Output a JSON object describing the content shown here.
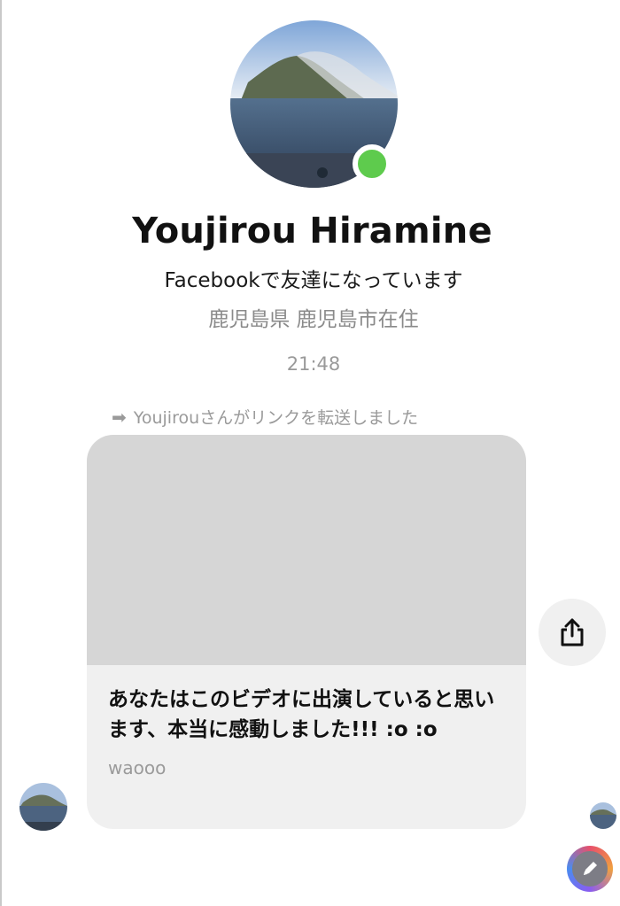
{
  "profile": {
    "name": "Youjirou  Hiramine",
    "friend_status": "Facebookで友達になっています",
    "location": "鹿児島県 鹿児島市在住",
    "online": true
  },
  "thread": {
    "timestamp": "21:48",
    "forward_note": "Youjirouさんがリンクを転送しました"
  },
  "shared_link": {
    "title": "あなたはこのビデオに出演していると思います、本当に感動しました!!! :o :o",
    "domain": "waooo"
  },
  "icons": {
    "forward": "arrow-right-icon",
    "share": "share-icon",
    "compose": "pencil-icon"
  },
  "colors": {
    "presence": "#5ecb4d",
    "card_bg": "#f0f0f0",
    "media_placeholder": "#d6d6d6"
  }
}
